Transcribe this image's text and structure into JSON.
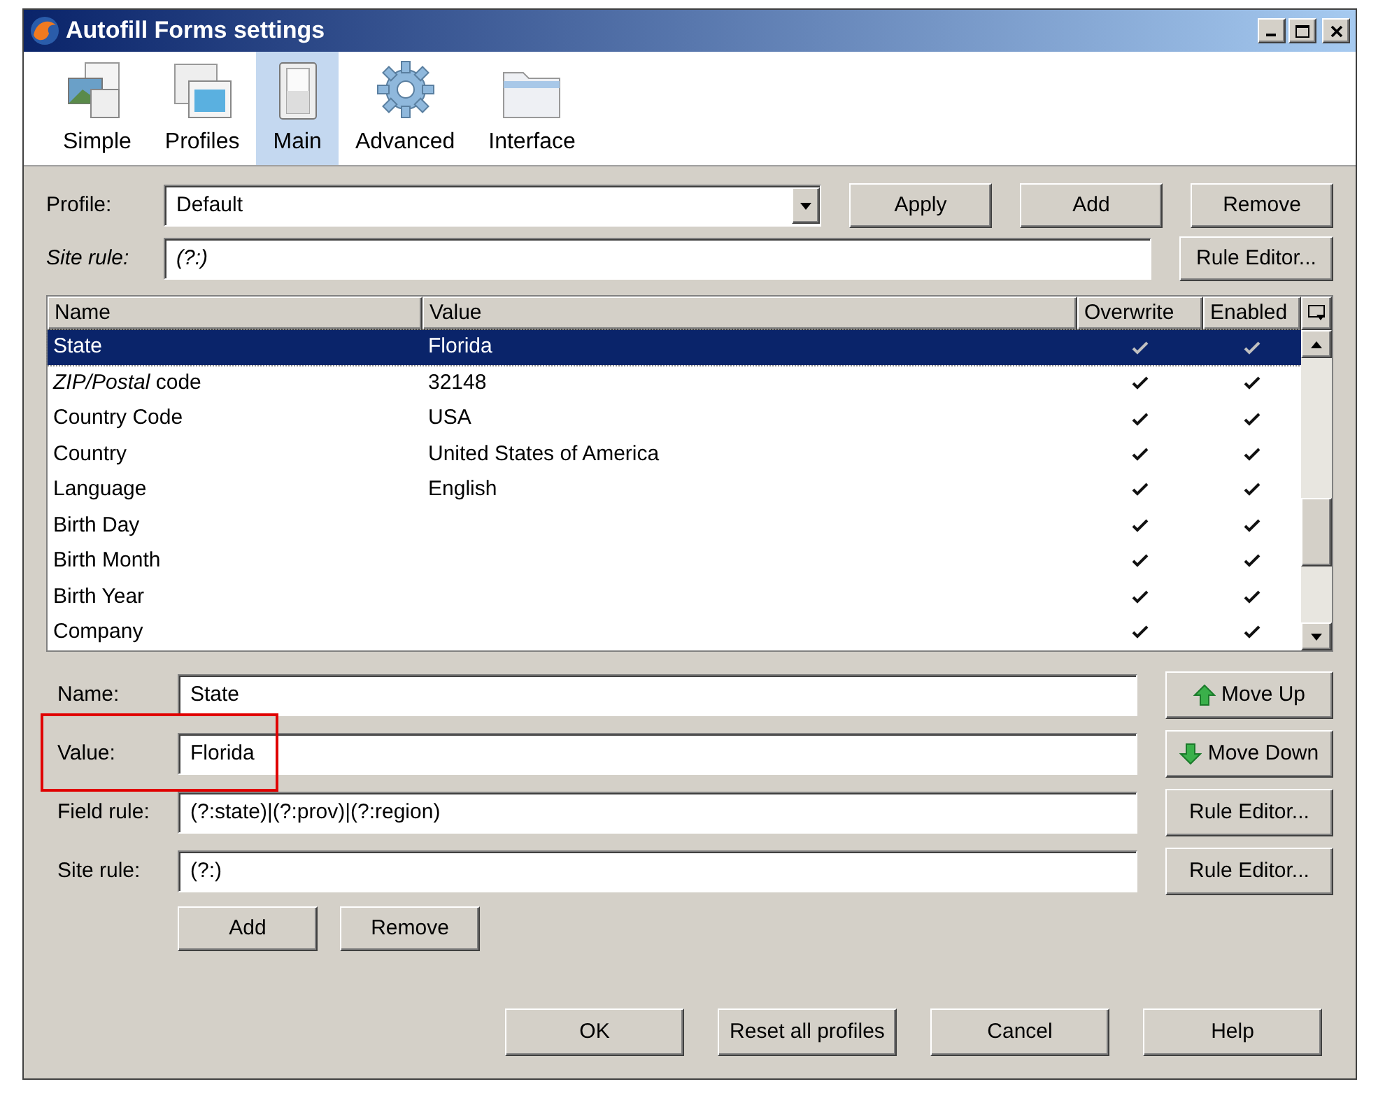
{
  "window": {
    "title": "Autofill Forms settings"
  },
  "tabs": [
    {
      "label": "Simple",
      "kind": "simple",
      "selected": false
    },
    {
      "label": "Profiles",
      "kind": "profiles",
      "selected": false
    },
    {
      "label": "Main",
      "kind": "main",
      "selected": true
    },
    {
      "label": "Advanced",
      "kind": "advanced",
      "selected": false
    },
    {
      "label": "Interface",
      "kind": "interface",
      "selected": false
    }
  ],
  "profile": {
    "label": "Profile:",
    "value": "Default",
    "buttons": [
      "Apply",
      "Add",
      "Remove"
    ]
  },
  "site_rule": {
    "label": "Site rule:",
    "value": "(?:)",
    "button": "Rule Editor..."
  },
  "table": {
    "columns": [
      "Name",
      "Value",
      "Overwrite",
      "Enabled"
    ],
    "rows": [
      {
        "name": "State",
        "value": "Florida",
        "overwrite": true,
        "enabled": true,
        "selected": true
      },
      {
        "name": "*ZIP/Postal* code",
        "value": "32148",
        "overwrite": true,
        "enabled": true,
        "selected": false
      },
      {
        "name": "Country Code",
        "value": "USA",
        "overwrite": true,
        "enabled": true,
        "selected": false
      },
      {
        "name": "Country",
        "value": "United States of America",
        "overwrite": true,
        "enabled": true,
        "selected": false
      },
      {
        "name": "Language",
        "value": "English",
        "overwrite": true,
        "enabled": true,
        "selected": false
      },
      {
        "name": "Birth Day",
        "value": "",
        "overwrite": true,
        "enabled": true,
        "selected": false
      },
      {
        "name": "Birth Month",
        "value": "",
        "overwrite": true,
        "enabled": true,
        "selected": false
      },
      {
        "name": "Birth Year",
        "value": "",
        "overwrite": true,
        "enabled": true,
        "selected": false
      },
      {
        "name": "Company",
        "value": "",
        "overwrite": true,
        "enabled": true,
        "selected": false
      }
    ]
  },
  "fields": [
    {
      "label": "Name:",
      "value": "State",
      "button": "Move Up",
      "kind": "up",
      "highlighted": false
    },
    {
      "label": "Value:",
      "value": "Florida",
      "button": "Move Down",
      "kind": "down",
      "highlighted": true
    },
    {
      "label": "Field rule:",
      "value": "(?:state)|(?:prov)|(?:region)",
      "button": "Rule Editor...",
      "kind": "plain",
      "highlighted": false
    },
    {
      "label": "Site rule:",
      "value": "(?:)",
      "button": "Rule Editor...",
      "kind": "plain",
      "highlighted": false
    }
  ],
  "field_buttons": [
    "Add",
    "Remove"
  ],
  "footer_buttons": [
    "OK",
    "Reset all profiles",
    "Cancel",
    "Help"
  ]
}
